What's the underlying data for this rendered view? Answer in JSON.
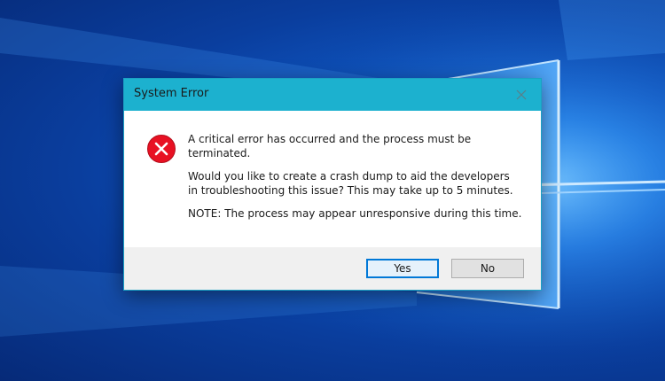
{
  "dialog": {
    "title": "System Error",
    "icon": "error-icon",
    "messages": [
      "A critical error has occurred and the process must be\nterminated.",
      "Would you like to create a crash dump to aid the developers\nin troubleshooting this issue? This may take up to 5 minutes.",
      "NOTE: The process may appear unresponsive during this time."
    ],
    "buttons": {
      "yes_label": "Yes",
      "no_label": "No"
    },
    "close_icon": "close-icon"
  },
  "colors": {
    "titlebar": "#1cb1cf",
    "error_red": "#e81123",
    "desktop_blue": "#0f58c4",
    "default_button_border": "#0078d7"
  },
  "desktop": {
    "wallpaper": "windows-10-logo-wallpaper"
  }
}
